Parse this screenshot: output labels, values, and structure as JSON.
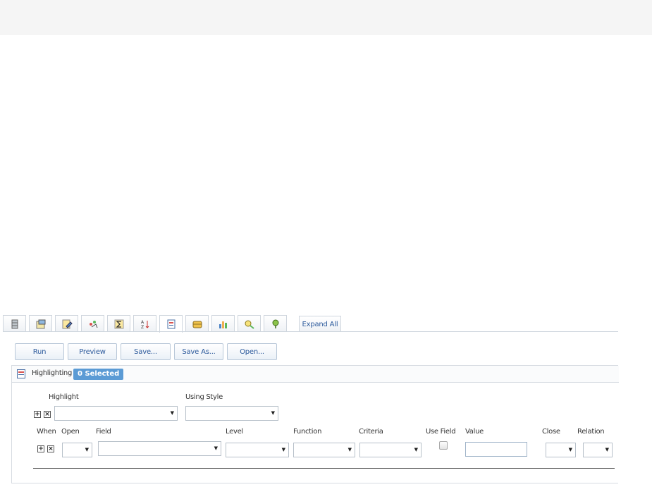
{
  "toolbar": {
    "tabs": [
      {
        "name": "data-source-icon"
      },
      {
        "name": "properties-icon"
      },
      {
        "name": "edit-icon"
      },
      {
        "name": "calculated-field-icon"
      },
      {
        "name": "summary-icon"
      },
      {
        "name": "sort-icon"
      },
      {
        "name": "highlighting-icon"
      },
      {
        "name": "grouping-icon"
      },
      {
        "name": "chart-icon"
      },
      {
        "name": "pivot-icon"
      },
      {
        "name": "map-icon"
      }
    ],
    "active_tab": "highlighting-icon",
    "expand_all": "Expand All"
  },
  "actions": {
    "run": "Run",
    "preview": "Preview",
    "save": "Save...",
    "save_as": "Save As...",
    "open": "Open..."
  },
  "highlighting": {
    "title": "Highlighting",
    "badge": "0 Selected",
    "highlight_label": "Highlight",
    "using_style_label": "Using Style",
    "highlight_value": "",
    "using_style_value": "",
    "columns": {
      "when": "When",
      "open": "Open",
      "field": "Field",
      "level": "Level",
      "function": "Function",
      "criteria": "Criteria",
      "use_field": "Use Field",
      "value": "Value",
      "close": "Close",
      "relation": "Relation"
    },
    "condition": {
      "open": "",
      "field": "",
      "level": "",
      "function": "",
      "criteria": "",
      "use_field": false,
      "value": "",
      "close": "",
      "relation": ""
    }
  },
  "colors": {
    "accent": "#5b9bd5",
    "link": "#2c5a9c",
    "border": "#cfd6de"
  }
}
